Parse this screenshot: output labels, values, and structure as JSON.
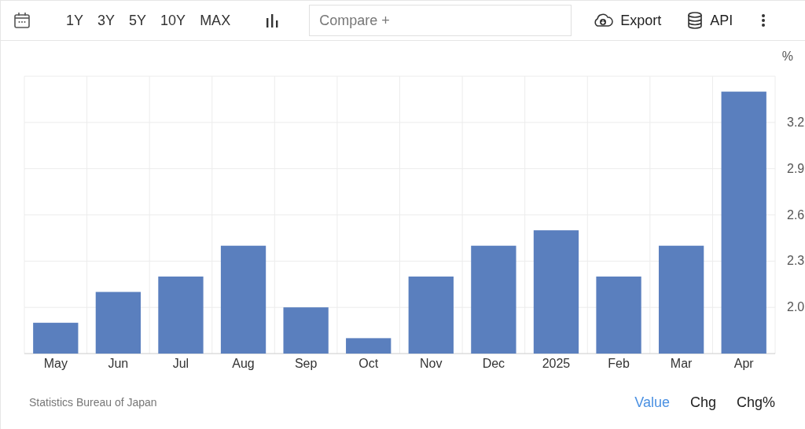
{
  "toolbar": {
    "ranges": [
      "1Y",
      "3Y",
      "5Y",
      "10Y",
      "MAX"
    ],
    "compare": {
      "placeholder": "Compare +"
    },
    "export": "Export",
    "api": "API"
  },
  "chart": {
    "unit": "%",
    "chart_data": {
      "type": "bar",
      "categories": [
        "May",
        "Jun",
        "Jul",
        "Aug",
        "Sep",
        "Oct",
        "Nov",
        "Dec",
        "2025",
        "Feb",
        "Mar",
        "Apr"
      ],
      "series": [
        {
          "color": "#5a7fbe",
          "values": [
            1.9,
            2.1,
            2.2,
            2.4,
            2.0,
            1.8,
            2.2,
            2.4,
            2.5,
            2.2,
            2.4,
            3.4
          ]
        }
      ],
      "ylim": [
        1.7,
        3.5
      ],
      "grid": true,
      "yticks": [
        {
          "value": 2.0,
          "label": "2.0"
        },
        {
          "value": 2.3,
          "label": "2.3"
        },
        {
          "value": 2.6,
          "label": "2.6"
        },
        {
          "value": 2.9,
          "label": "2.9"
        },
        {
          "value": 3.2,
          "label": "3.2"
        }
      ]
    }
  },
  "footer": {
    "source": "Statistics Bureau of Japan",
    "tabs": [
      {
        "label": "Value",
        "selected": true
      },
      {
        "label": "Chg",
        "selected": false
      },
      {
        "label": "Chg%",
        "selected": false
      }
    ]
  }
}
